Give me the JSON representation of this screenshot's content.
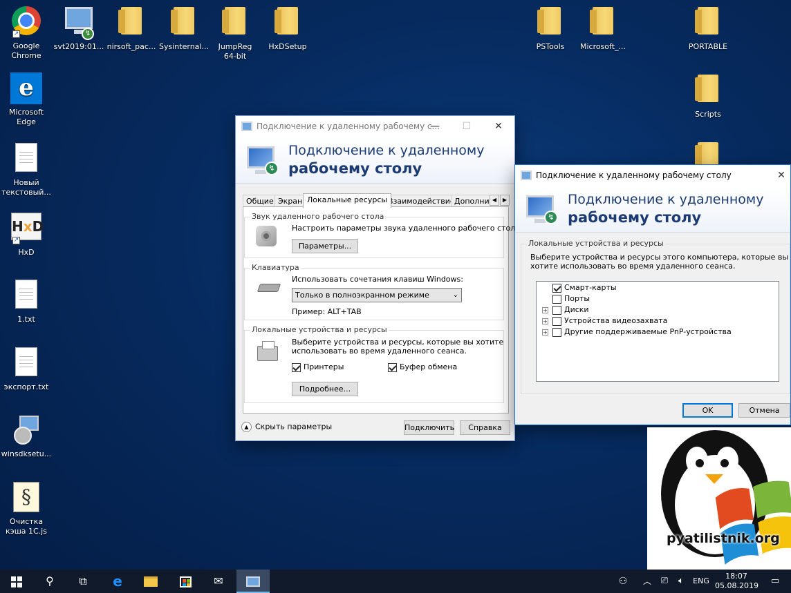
{
  "desktop": {
    "icons": [
      {
        "label": "Google\nChrome",
        "icon": "chrome-icon"
      },
      {
        "label": "svt2019:01...",
        "icon": "remote-desktop-shortcut-icon"
      },
      {
        "label": "nirsoft_pac...",
        "icon": "folder-icon"
      },
      {
        "label": "Sysinternal...",
        "icon": "folder-icon"
      },
      {
        "label": "JumpReg\n64-bit",
        "icon": "folder-icon"
      },
      {
        "label": "HxDSetup",
        "icon": "folder-icon"
      },
      {
        "label": "PSTools",
        "icon": "folder-icon"
      },
      {
        "label": "Microsoft_...",
        "icon": "folder-icon"
      },
      {
        "label": "PORTABLE",
        "icon": "folder-icon"
      },
      {
        "label": "Microsoft\nEdge",
        "icon": "edge-icon"
      },
      {
        "label": "Scripts",
        "icon": "folder-icon"
      },
      {
        "label": "Новый\nтекстовый...",
        "icon": "text-file-icon"
      },
      {
        "label": "HxD",
        "icon": "hxd-icon"
      },
      {
        "label": "1.txt",
        "icon": "text-file-icon"
      },
      {
        "label": "экспорт.txt",
        "icon": "text-file-icon"
      },
      {
        "label": "winsdksetu...",
        "icon": "installer-icon"
      },
      {
        "label": "Очистка\nкэша 1С.js",
        "icon": "script-file-icon"
      }
    ]
  },
  "rdp_main": {
    "title": "Подключение к удаленному рабочему с...",
    "banner_line1": "Подключение к удаленному",
    "banner_line2": "рабочему столу",
    "tabs": [
      "Общие",
      "Экран",
      "Локальные ресурсы",
      "Взаимодействие",
      "Дополни"
    ],
    "selected_tab": "Локальные ресурсы",
    "sound_group": {
      "title": "Звук удаленного рабочего стола",
      "desc": "Настроить параметры звука удаленного рабочего стола.",
      "button": "Параметры..."
    },
    "keyboard_group": {
      "title": "Клавиатура",
      "desc": "Использовать сочетания клавиш Windows:",
      "select_value": "Только в полноэкранном режиме",
      "example": "Пример: ALT+TAB"
    },
    "local_group": {
      "title": "Локальные устройства и ресурсы",
      "desc1": "Выберите устройства и ресурсы, которые вы хотите",
      "desc2": "использовать во время удаленного сеанса.",
      "printers": "Принтеры",
      "clipboard": "Буфер обмена",
      "button": "Подробнее..."
    },
    "hide_options": "Скрыть параметры",
    "connect": "Подключить",
    "help": "Справка"
  },
  "rdp_devices": {
    "title": "Подключение к удаленному рабочему столу",
    "banner_line1": "Подключение к удаленному",
    "banner_line2": "рабочему столу",
    "group_title": "Локальные устройства и ресурсы",
    "desc1": "Выберите устройства и ресурсы этого компьютера, которые вы",
    "desc2": "хотите использовать во время удаленного сеанса.",
    "items": [
      {
        "label": "Смарт-карты",
        "checked": true,
        "expandable": false
      },
      {
        "label": "Порты",
        "checked": false,
        "expandable": false
      },
      {
        "label": "Диски",
        "checked": false,
        "expandable": true
      },
      {
        "label": "Устройства видеозахвата",
        "checked": false,
        "expandable": true
      },
      {
        "label": "Другие поддерживаемые PnP-устройства",
        "checked": false,
        "expandable": true
      }
    ],
    "ok": "OK",
    "cancel": "Отмена"
  },
  "logo": {
    "text": "pyatilistnik.org"
  },
  "taskbar": {
    "lang": "ENG",
    "time": "18:07",
    "date": "05.08.2019"
  }
}
